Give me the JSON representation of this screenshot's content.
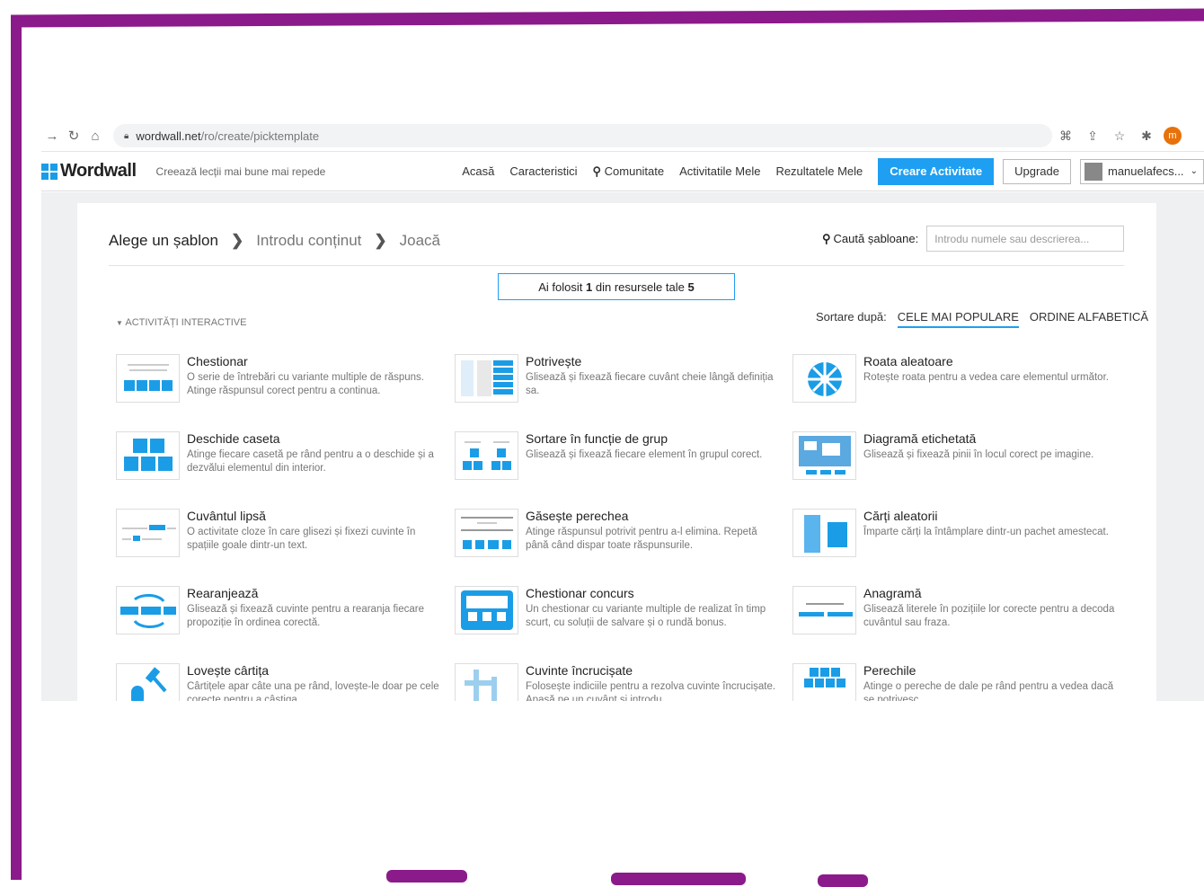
{
  "browser": {
    "url_host": "wordwall.net",
    "url_path": "/ro/create/picktemplate",
    "profile_initial": "m"
  },
  "header": {
    "logo": "Wordwall",
    "tagline": "Creează lecții mai bune mai repede",
    "nav": [
      "Acasă",
      "Caracteristici",
      "Comunitate",
      "Activitatile Mele",
      "Rezultatele Mele"
    ],
    "create_button": "Creare Activitate",
    "upgrade_button": "Upgrade",
    "user": "manuelafecs..."
  },
  "steps": {
    "current": "Alege un șablon",
    "step2": "Introdu conținut",
    "step3": "Joacă"
  },
  "search": {
    "label": "Caută șabloane:",
    "placeholder": "Introdu numele sau descrierea..."
  },
  "quota": {
    "prefix": "Ai folosit ",
    "used": "1",
    "middle": " din resursele tale ",
    "total": "5"
  },
  "section_title": "ACTIVITĂȚI INTERACTIVE",
  "sort": {
    "label": "Sortare după:",
    "popular": "CELE MAI POPULARE",
    "alpha": "ORDINE ALFABETICĂ"
  },
  "templates": [
    {
      "name": "Chestionar",
      "desc": "O serie de întrebări cu variante multiple de răspuns. Atinge răspunsul corect pentru a continua."
    },
    {
      "name": "Potrivește",
      "desc": "Glisează și fixează fiecare cuvânt cheie lângă definiția sa."
    },
    {
      "name": "Roata aleatoare",
      "desc": "Rotește roata pentru a vedea care elementul următor."
    },
    {
      "name": "Deschide caseta",
      "desc": "Atinge fiecare casetă pe rând pentru a o deschide și a dezvălui elementul din interior."
    },
    {
      "name": "Sortare în funcție de grup",
      "desc": "Glisează și fixează fiecare element în grupul corect."
    },
    {
      "name": "Diagramă etichetată",
      "desc": "Glisează și fixează pinii în locul corect pe imagine."
    },
    {
      "name": "Cuvântul lipsă",
      "desc": "O activitate cloze în care glisezi și fixezi cuvinte în spațiile goale dintr-un text."
    },
    {
      "name": "Găsește perechea",
      "desc": "Atinge răspunsul potrivit pentru a-l elimina. Repetă până când dispar toate răspunsurile."
    },
    {
      "name": "Cărți aleatorii",
      "desc": "Împarte cărți la întâmplare dintr-un pachet amestecat."
    },
    {
      "name": "Rearanjează",
      "desc": "Glisează și fixează cuvinte pentru a rearanja fiecare propoziție în ordinea corectă."
    },
    {
      "name": "Chestionar concurs",
      "desc": "Un chestionar cu variante multiple de realizat în timp scurt, cu soluții de salvare și o rundă bonus."
    },
    {
      "name": "Anagramă",
      "desc": "Glisează literele în pozițiile lor corecte pentru a decoda cuvântul sau fraza."
    },
    {
      "name": "Lovește cârtița",
      "desc": "Cârtițele apar câte una pe rând, lovește-le doar pe cele corecte pentru a câștiga."
    },
    {
      "name": "Cuvinte încrucișate",
      "desc": "Folosește indiciile pentru a rezolva cuvinte încrucișate. Apasă pe un cuvânt și introdu."
    },
    {
      "name": "Perechile",
      "desc": "Atinge o pereche de dale pe rând pentru a vedea dacă se potrivesc."
    }
  ],
  "colors": {
    "accent": "#1e9ff2",
    "frame": "#8b1a8a"
  }
}
